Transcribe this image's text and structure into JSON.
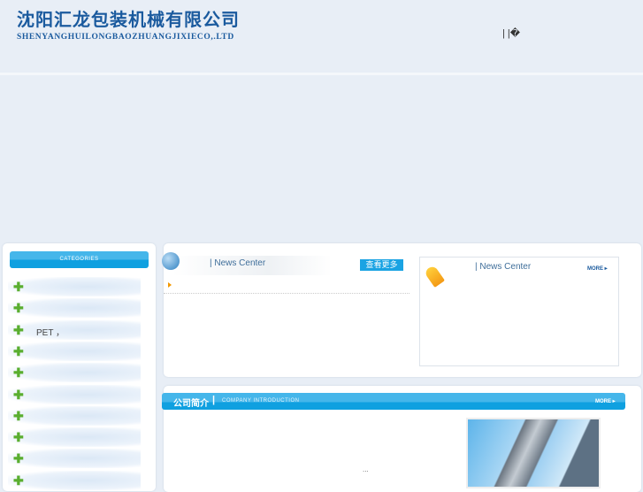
{
  "header": {
    "company_cn": "沈阳汇龙包装机械有限公司",
    "company_en": "SHENYANGHUILONGBAOZHUANGJIXIECO,.LTD",
    "top_links": "|   |�"
  },
  "sidebar": {
    "title": "CATEGORIES",
    "items": [
      {
        "label": ""
      },
      {
        "label": ""
      },
      {
        "label": "PET ，"
      },
      {
        "label": ""
      },
      {
        "label": ""
      },
      {
        "label": ""
      },
      {
        "label": ""
      },
      {
        "label": ""
      },
      {
        "label": ""
      },
      {
        "label": ""
      }
    ]
  },
  "news": {
    "title": "|  News Center",
    "more": "查看更多"
  },
  "news2": {
    "title": "|  News Center",
    "more": "MORE ▸"
  },
  "intro": {
    "title_cn": "公司简介",
    "sep": "|",
    "title_en": "COMPANY INTRODUCTION",
    "more": "MORE ▸",
    "ellipsis": "..."
  }
}
